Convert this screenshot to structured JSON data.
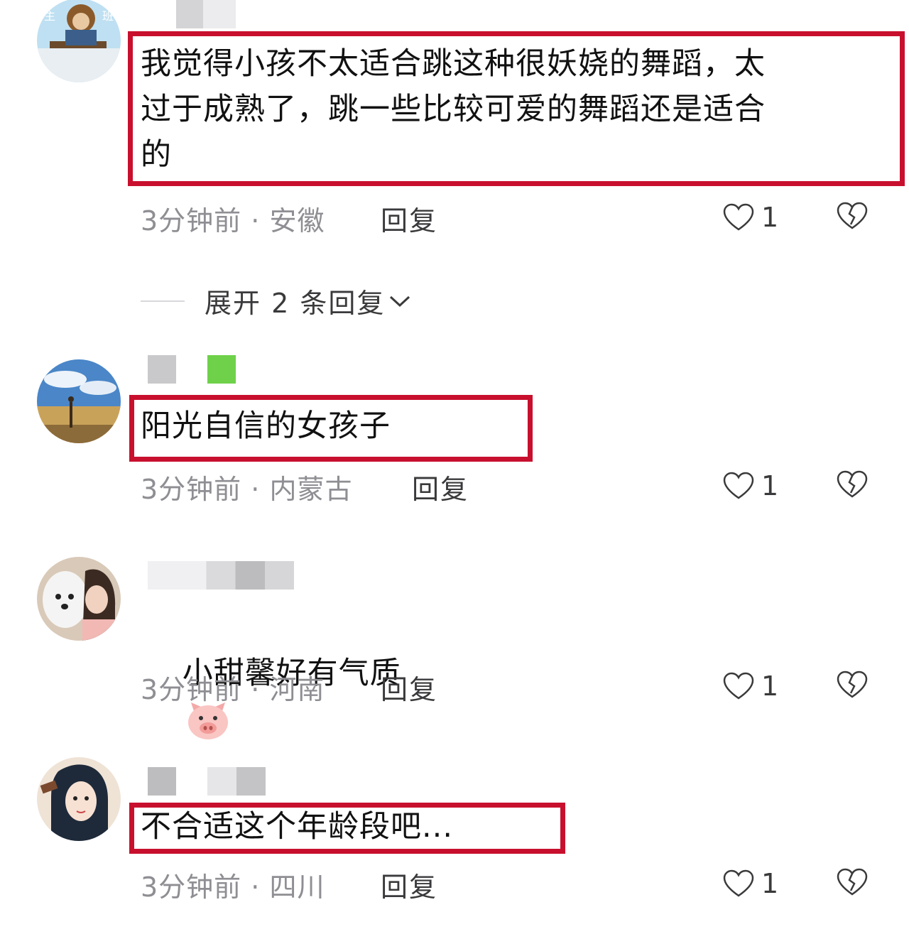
{
  "comments": [
    {
      "text": "我觉得小孩不太适合跳这种很妖娆的舞蹈，太\n过于成熟了，跳一些比较可爱的舞蹈还是适合\n的",
      "time": "3分钟前",
      "location": "安徽",
      "reply_label": "回复",
      "likes": "1",
      "expand_label": "展开 2 条回复"
    },
    {
      "text": "阳光自信的女孩子",
      "time": "3分钟前",
      "location": "内蒙古",
      "reply_label": "回复",
      "likes": "1"
    },
    {
      "text": "小甜馨好有气质",
      "emoji": "pig-face-icon",
      "time": "3分钟前",
      "location": "河南",
      "reply_label": "回复",
      "likes": "1"
    },
    {
      "text": "不合适这个年龄段吧...",
      "time": "3分钟前",
      "location": "四川",
      "reply_label": "回复",
      "likes": "1"
    }
  ],
  "colors": {
    "highlight_box": "#c8102e",
    "meta_text": "#8e8e93",
    "action_text": "#3a3a3c"
  }
}
